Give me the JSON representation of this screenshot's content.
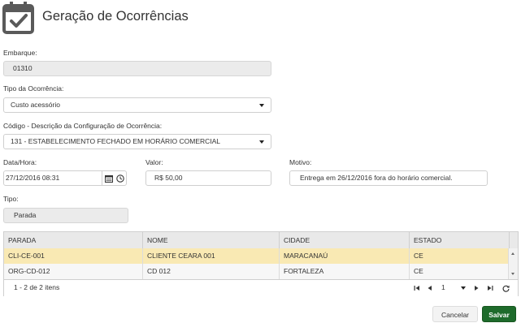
{
  "page": {
    "title": "Geração de Ocorrências"
  },
  "form": {
    "embarque": {
      "label": "Embarque:",
      "value": "01310"
    },
    "tipo_ocorrencia": {
      "label": "Tipo da Ocorrência:",
      "value": "Custo acessório"
    },
    "codigo_descricao": {
      "label": "Código - Descrição da Configuração de Ocorrência:",
      "value": "131 - ESTABELECIMENTO FECHADO EM HORÁRIO COMERCIAL"
    },
    "data_hora": {
      "label": "Data/Hora:",
      "value": "27/12/2016 08:31"
    },
    "valor": {
      "label": "Valor:",
      "value": "R$ 50,00"
    },
    "motivo": {
      "label": "Motivo:",
      "value": "Entrega em 26/12/2016 fora do horário comercial."
    },
    "tipo": {
      "label": "Tipo:",
      "value": "Parada"
    }
  },
  "grid": {
    "columns": [
      "PARADA",
      "NOME",
      "CIDADE",
      "ESTADO"
    ],
    "rows": [
      [
        "CLI-CE-001",
        "CLIENTE CEARA 001",
        "MARACANAÚ",
        "CE"
      ],
      [
        "ORG-CD-012",
        "CD 012",
        "FORTALEZA",
        "CE"
      ]
    ],
    "pager": {
      "info": "1 - 2 de 2 itens",
      "page": "1"
    }
  },
  "actions": {
    "cancel": "Cancelar",
    "save": "Salvar"
  },
  "colors": {
    "save_button": "#1e6b2b",
    "selected_row": "#f9e9b3",
    "readonly_field": "#ebebeb",
    "grid_header": "#e9e9e9"
  },
  "icons": [
    "calendar-check-icon",
    "dropdown-caret-icon",
    "calendar-icon",
    "clock-icon",
    "scroll-up-icon",
    "scroll-down-icon",
    "first-page-icon",
    "prev-page-icon",
    "next-page-icon",
    "last-page-icon",
    "refresh-icon"
  ]
}
